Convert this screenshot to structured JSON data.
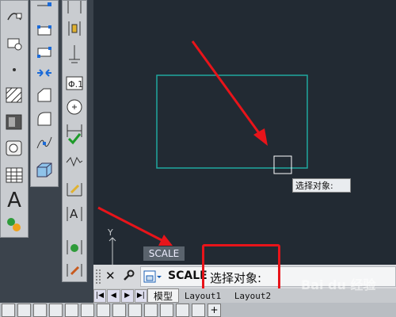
{
  "command": {
    "history_label": "SCALE",
    "prompt_cmd": "SCALE",
    "prompt_text": "选择对象:"
  },
  "tooltip": {
    "text": "选择对象:"
  },
  "tabs": [
    {
      "label": "模型"
    },
    {
      "label": "Layout1"
    },
    {
      "label": "Layout2"
    }
  ],
  "glyphs": {
    "text_tool": "A",
    "axis_y": "Y",
    "bar_x": "✕",
    "bar_wrench": "🔧",
    "plus": "+"
  },
  "colors": {
    "canvas_bg": "#222a33",
    "rectangle": "#1fa7a0",
    "arrow": "#e8141a",
    "highlight_box": "#e8141a"
  },
  "watermark": "Bai du 经验"
}
